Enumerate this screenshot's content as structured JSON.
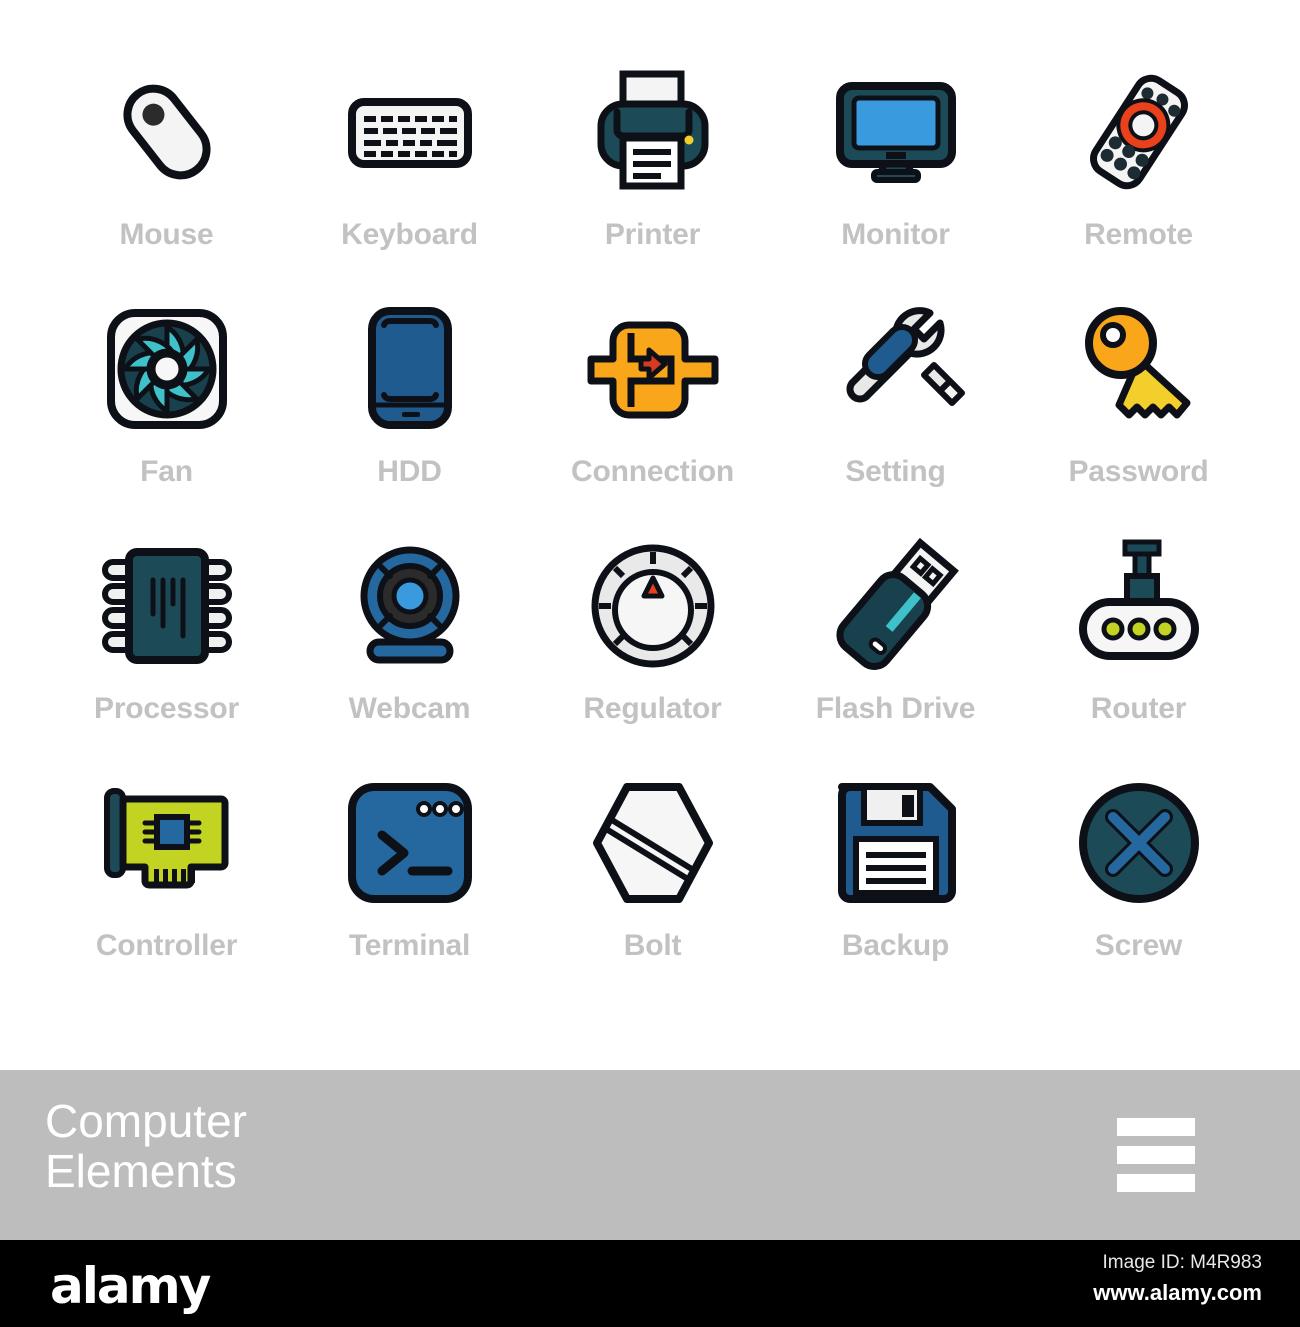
{
  "palette": {
    "outline": "#0d1117",
    "dark_teal": "#1d4a57",
    "deep_teal": "#18414d",
    "blue": "#1f5b8f",
    "bright_blue": "#3a9ade",
    "steel_blue": "#24689f",
    "cyan": "#3fc1c9",
    "orange": "#f9a61a",
    "amber": "#fbc02d",
    "yellow": "#f2cf2a",
    "red_orange": "#e8411c",
    "red": "#d63b22",
    "lime": "#c3d321",
    "off_white": "#f4f4f4",
    "light_gray": "#e4e4e4",
    "label_gray": "#c2c2c2",
    "footer_gray": "#bdbdbd"
  },
  "grid": {
    "columns": 5,
    "rows": 4,
    "items": [
      {
        "label": "Mouse",
        "icon": "mouse-icon"
      },
      {
        "label": "Keyboard",
        "icon": "keyboard-icon"
      },
      {
        "label": "Printer",
        "icon": "printer-icon"
      },
      {
        "label": "Monitor",
        "icon": "monitor-icon"
      },
      {
        "label": "Remote",
        "icon": "remote-icon"
      },
      {
        "label": "Fan",
        "icon": "fan-icon"
      },
      {
        "label": "HDD",
        "icon": "hdd-icon"
      },
      {
        "label": "Connection",
        "icon": "connection-icon"
      },
      {
        "label": "Setting",
        "icon": "setting-icon"
      },
      {
        "label": "Password",
        "icon": "password-key-icon"
      },
      {
        "label": "Processor",
        "icon": "processor-icon"
      },
      {
        "label": "Webcam",
        "icon": "webcam-icon"
      },
      {
        "label": "Regulator",
        "icon": "regulator-icon"
      },
      {
        "label": "Flash Drive",
        "icon": "flash-drive-icon"
      },
      {
        "label": "Router",
        "icon": "router-icon"
      },
      {
        "label": "Controller",
        "icon": "controller-card-icon"
      },
      {
        "label": "Terminal",
        "icon": "terminal-icon"
      },
      {
        "label": "Bolt",
        "icon": "bolt-icon"
      },
      {
        "label": "Backup",
        "icon": "floppy-disk-icon"
      },
      {
        "label": "Screw",
        "icon": "screw-icon"
      }
    ]
  },
  "footer": {
    "title": "Computer\nElements",
    "menu_icon": "hamburger-icon"
  },
  "watermark": {
    "logo": "alamy",
    "image_id": "Image ID: M4R983",
    "url": "www.alamy.com"
  }
}
